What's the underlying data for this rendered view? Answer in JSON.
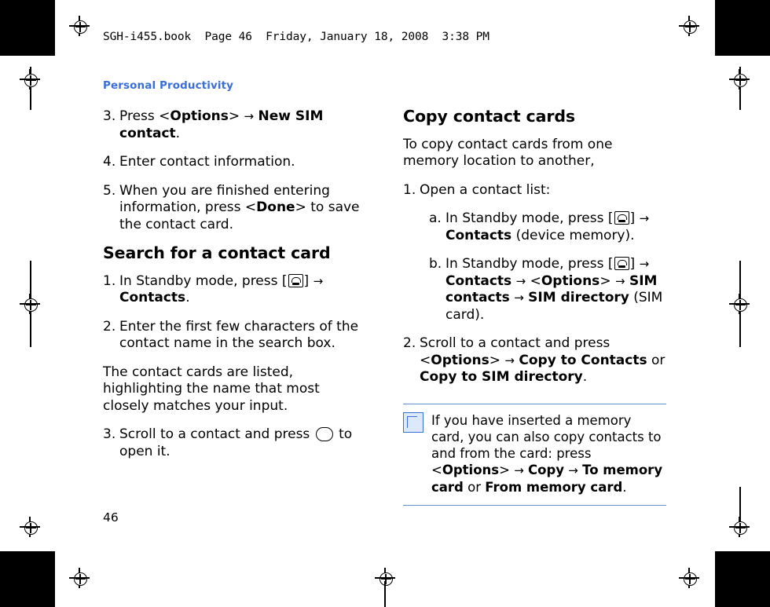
{
  "header": {
    "file_line": "SGH-i455.book  Page 46  Friday, January 18, 2008  3:38 PM"
  },
  "section": {
    "label": "Personal Productivity",
    "accent_color": "#3a6fd8"
  },
  "page_number": "46",
  "left_column": {
    "steps_continued": [
      {
        "num": "3.",
        "parts": [
          {
            "t": "Press <",
            "b": false
          },
          {
            "t": "Options",
            "b": true
          },
          {
            "t": "> ",
            "b": false
          },
          {
            "t": "→",
            "b": false,
            "arrow": true
          },
          {
            "t": " ",
            "b": false
          },
          {
            "t": "New SIM contact",
            "b": true
          },
          {
            "t": ".",
            "b": false
          }
        ]
      },
      {
        "num": "4.",
        "parts": [
          {
            "t": "Enter contact information.",
            "b": false
          }
        ]
      },
      {
        "num": "5.",
        "parts": [
          {
            "t": "When you are finished entering information, press <",
            "b": false
          },
          {
            "t": "Done",
            "b": true
          },
          {
            "t": "> to save the contact card.",
            "b": false
          }
        ]
      }
    ],
    "heading": "Search for a contact card",
    "steps": [
      {
        "num": "1.",
        "parts": [
          {
            "t": "In Standby mode, press [",
            "b": false
          },
          {
            "t": "KEY",
            "icon": "contacts-key-icon"
          },
          {
            "t": "] ",
            "b": false
          },
          {
            "t": "→",
            "b": false,
            "arrow": true
          },
          {
            "t": " ",
            "b": false
          },
          {
            "t": "Contacts",
            "b": true
          },
          {
            "t": ".",
            "b": false
          }
        ]
      },
      {
        "num": "2.",
        "parts": [
          {
            "t": "Enter the first few characters of the contact name in the search box.",
            "b": false
          }
        ]
      },
      {
        "num": "",
        "plain": true,
        "parts": [
          {
            "t": "The contact cards are listed, highlighting the name that most closely matches your input.",
            "b": false
          }
        ]
      },
      {
        "num": "3.",
        "parts": [
          {
            "t": "Scroll to a contact and press ",
            "b": false
          },
          {
            "t": "OK",
            "okkey": true
          },
          {
            "t": " to open it.",
            "b": false
          }
        ]
      }
    ]
  },
  "right_column": {
    "heading": "Copy contact cards",
    "intro": "To copy contact cards from one memory location to another,",
    "steps": [
      {
        "num": "1.",
        "parts": [
          {
            "t": "Open a contact list:",
            "b": false
          }
        ]
      },
      {
        "num": "a.",
        "sub": true,
        "parts": [
          {
            "t": "In Standby mode, press [",
            "b": false
          },
          {
            "t": "KEY",
            "icon": "contacts-key-icon"
          },
          {
            "t": "] ",
            "b": false
          },
          {
            "t": "→",
            "b": false,
            "arrow": true
          },
          {
            "t": " ",
            "b": false
          },
          {
            "t": "Contacts",
            "b": true
          },
          {
            "t": " (device memory).",
            "b": false
          }
        ]
      },
      {
        "num": "b.",
        "sub": true,
        "parts": [
          {
            "t": "In Standby mode, press [",
            "b": false
          },
          {
            "t": "KEY",
            "icon": "contacts-key-icon"
          },
          {
            "t": "] ",
            "b": false
          },
          {
            "t": "→",
            "b": false,
            "arrow": true
          },
          {
            "t": " ",
            "b": false
          },
          {
            "t": "Contacts",
            "b": true
          },
          {
            "t": " ",
            "b": false
          },
          {
            "t": "→",
            "b": false,
            "arrow": true
          },
          {
            "t": " <",
            "b": false
          },
          {
            "t": "Options",
            "b": true
          },
          {
            "t": "> ",
            "b": false
          },
          {
            "t": "→",
            "b": false,
            "arrow": true
          },
          {
            "t": " ",
            "b": false
          },
          {
            "t": "SIM contacts",
            "b": true
          },
          {
            "t": " ",
            "b": false
          },
          {
            "t": "→",
            "b": false,
            "arrow": true
          },
          {
            "t": " ",
            "b": false
          },
          {
            "t": "SIM directory",
            "b": true
          },
          {
            "t": " (SIM card).",
            "b": false
          }
        ]
      },
      {
        "num": "2.",
        "parts": [
          {
            "t": "Scroll to a contact and press <",
            "b": false
          },
          {
            "t": "Options",
            "b": true
          },
          {
            "t": "> ",
            "b": false
          },
          {
            "t": "→",
            "b": false,
            "arrow": true
          },
          {
            "t": " ",
            "b": false
          },
          {
            "t": "Copy to Contacts",
            "b": true
          },
          {
            "t": " or ",
            "b": false
          },
          {
            "t": "Copy to SIM directory",
            "b": true
          },
          {
            "t": ".",
            "b": false
          }
        ]
      }
    ],
    "note": {
      "icon": "note-pencil-icon",
      "parts": [
        {
          "t": "If you have inserted a memory card, you can also copy contacts to and from the card: press <",
          "b": false
        },
        {
          "t": "Options",
          "b": true
        },
        {
          "t": "> ",
          "b": false
        },
        {
          "t": "→",
          "b": false,
          "arrow": true
        },
        {
          "t": " ",
          "b": false
        },
        {
          "t": "Copy",
          "b": true
        },
        {
          "t": " ",
          "b": false
        },
        {
          "t": "→",
          "b": false,
          "arrow": true
        },
        {
          "t": " ",
          "b": false
        },
        {
          "t": "To memory card",
          "b": true
        },
        {
          "t": " or ",
          "b": false
        },
        {
          "t": "From memory card",
          "b": true
        },
        {
          "t": ".",
          "b": false
        }
      ]
    }
  }
}
